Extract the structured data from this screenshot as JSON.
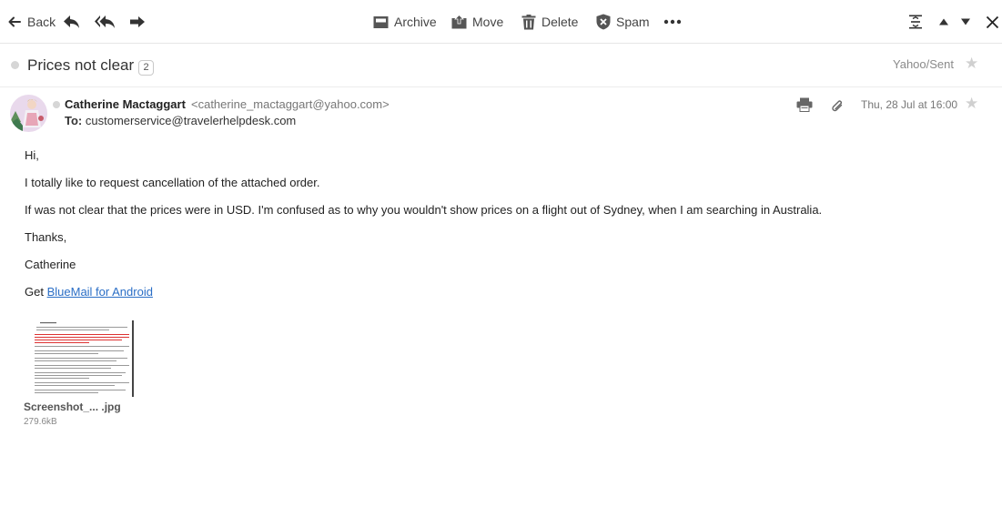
{
  "toolbar": {
    "back_label": "Back",
    "archive_label": "Archive",
    "move_label": "Move",
    "delete_label": "Delete",
    "spam_label": "Spam"
  },
  "thread": {
    "subject": "Prices not clear",
    "message_count": "2",
    "folder": "Yahoo/Sent"
  },
  "message": {
    "from_name": "Catherine Mactaggart",
    "from_email": "<catherine_mactaggart@yahoo.com>",
    "to_label": "To:",
    "to_address": "customerservice@travelerhelpdesk.com",
    "date": "Thu, 28 Jul at 16:00",
    "body": {
      "greeting": "Hi,",
      "line1": "I totally like to request cancellation of the attached order.",
      "line2": "If was not clear that the prices were in USD. I'm confused as to why you wouldn't show prices on a flight out of Sydney, when I am searching in Australia.",
      "thanks": "Thanks,",
      "signature": "Catherine",
      "footer_prefix": "Get",
      "footer_link": "BlueMail for Android"
    },
    "attachment": {
      "name": "Screenshot_... .jpg",
      "size": "279.6kB"
    }
  },
  "colors": {
    "link": "#2a6ec6",
    "muted": "#777777"
  }
}
